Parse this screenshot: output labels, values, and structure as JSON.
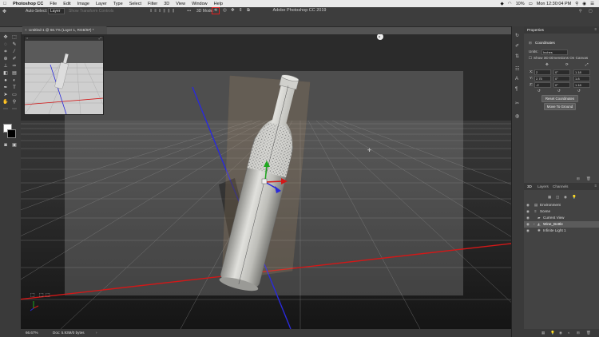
{
  "menubar": {
    "apple": "",
    "app": "Photoshop CC",
    "items": [
      "File",
      "Edit",
      "Image",
      "Layer",
      "Type",
      "Select",
      "Filter",
      "3D",
      "View",
      "Window",
      "Help"
    ],
    "battery": "10%",
    "clock": "Mon 12:30:04 PM"
  },
  "window_title": "Adobe Photoshop CC 2019",
  "options": {
    "auto_select_label": "Auto-Select:",
    "auto_select_value": "Layer",
    "show_transform": "Show Transform Controls",
    "mode_label": "3D Mode:"
  },
  "document": {
    "tab": "Untitled-1 @ 66.7% (Layer 1, RGB/8#) *"
  },
  "statusbar": {
    "zoom": "66.67%",
    "doc": "Doc: 5.93M/0 bytes"
  },
  "properties": {
    "tab": "Properties",
    "section": "Coordinates",
    "units_label": "Units:",
    "units_value": "Inches",
    "show_dims": "Show 3D Dimensions On Canvas",
    "x_label": "X:",
    "x_val": "2",
    "y_label": "Y:",
    "y_val": "2.75",
    "z_label": "Z:",
    "z_val": "-2",
    "rx_val": "0°",
    "ry_val": "0°",
    "rz_val": "0°",
    "sx_val": "1.18",
    "sy_val": "1.8",
    "sz_val": "1.18",
    "reset_btn": "Reset Coordinates",
    "move_btn": "Move To Ground"
  },
  "layers": {
    "tabs": [
      "3D",
      "Layers",
      "Channels"
    ],
    "rows": [
      {
        "label": "Environment",
        "indent": 0
      },
      {
        "label": "Scene",
        "indent": 0
      },
      {
        "label": "Current View",
        "indent": 1
      },
      {
        "label": "Wine_Bottle",
        "indent": 1,
        "selected": true
      },
      {
        "label": "Infinite Light 1",
        "indent": 1
      }
    ]
  },
  "colors": {
    "axis_x": "#d21818",
    "axis_z": "#2a2adb",
    "bottle": "#c8c8c4",
    "highlight_box": "#e02020"
  }
}
